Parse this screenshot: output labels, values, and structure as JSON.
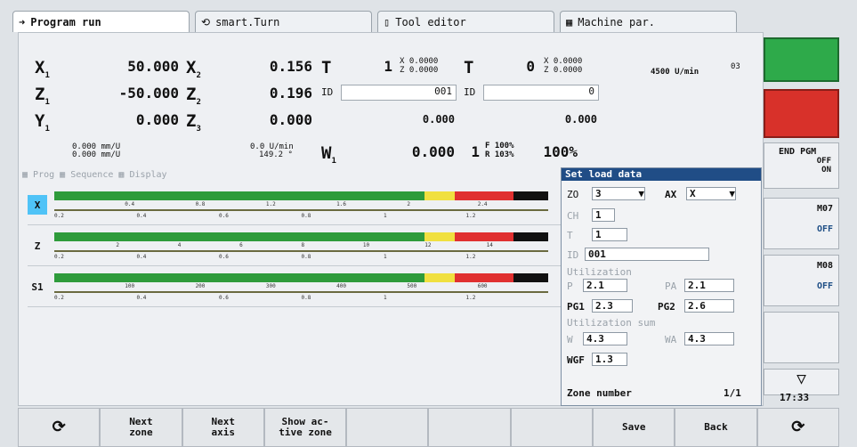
{
  "tabs": [
    {
      "label": "Program run",
      "icon": "arrow-right-icon"
    },
    {
      "label": "smart.Turn",
      "icon": "arrow-circle-icon"
    },
    {
      "label": "Tool editor",
      "icon": "document-icon"
    },
    {
      "label": "Machine par.",
      "icon": "table-icon"
    }
  ],
  "axes": {
    "x1": "50.000",
    "x2": "0.156",
    "z1": "-50.000",
    "z2": "0.196",
    "y1": "0.000",
    "z3": "0.000",
    "w1": "0.000"
  },
  "tool": {
    "T1": "1",
    "x1": "X 0.0000",
    "z1": "Z 0.0000",
    "T2": "0",
    "x2": "X 0.0000",
    "z2": "Z 0.0000",
    "id1": "001",
    "id2": "0",
    "t1pos": "0.000",
    "t2pos": "0.000"
  },
  "feed": {
    "f1": "0.000 mm/U",
    "f2": "0.000 mm/U",
    "f3": "0.0 U/min",
    "f4": "149.2 °",
    "count": "1",
    "speed": "4500 U/min",
    "spindle_pct": "100%",
    "fr": "F 100%",
    "rr": "R 103%",
    "s1": "S",
    "pct": "03"
  },
  "overview": {
    "prog": "Prog",
    "sequence": "Sequence",
    "display": "Display"
  },
  "chart": {
    "rows": [
      {
        "label": "X",
        "top": [
          "0.4",
          "0.8",
          "1.2",
          "1.6",
          "2",
          "2.4"
        ],
        "bot": [
          "0.2",
          "0.4",
          "0.6",
          "0.8",
          "1",
          "1.2"
        ]
      },
      {
        "label": "Z",
        "top": [
          "2",
          "4",
          "6",
          "8",
          "10",
          "12",
          "14"
        ],
        "bot": [
          "0.2",
          "0.4",
          "0.6",
          "0.8",
          "1",
          "1.2"
        ]
      },
      {
        "label": "S1",
        "top": [
          "100",
          "200",
          "300",
          "400",
          "500",
          "600"
        ],
        "bot": [
          "0.2",
          "0.4",
          "0.6",
          "0.8",
          "1",
          "1.2"
        ]
      }
    ]
  },
  "dialog": {
    "title": "Set load data",
    "zo_label": "ZO",
    "zo": "3",
    "ax_label": "AX",
    "ax": "X",
    "ch": "CH",
    "ch_val": "1",
    "t": "T",
    "t_val": "1",
    "id": "ID",
    "id_val": "001",
    "util": "Utilization",
    "p": "P",
    "p_val": "2.1",
    "pa": "PA",
    "pa_val": "2.1",
    "pg1": "PG1",
    "pg1_val": "2.3",
    "pg2": "PG2",
    "pg2_val": "2.6",
    "sum": "Utilization sum",
    "w": "W",
    "w_val": "4.3",
    "wa": "WA",
    "wa_val": "4.3",
    "wgf": "WGF",
    "wgf_val": "1.3",
    "zone": "Zone number",
    "page": "1/1"
  },
  "right": {
    "end": "END PGM",
    "off": "OFF",
    "on": "ON",
    "m07": "M07",
    "m08": "M08",
    "off2": "OFF",
    "time": "17:33"
  },
  "bottom": [
    "",
    "Next\nzone",
    "Next\naxis",
    "Show ac-\ntive zone",
    "",
    "",
    "",
    "Save",
    "Back",
    ""
  ]
}
